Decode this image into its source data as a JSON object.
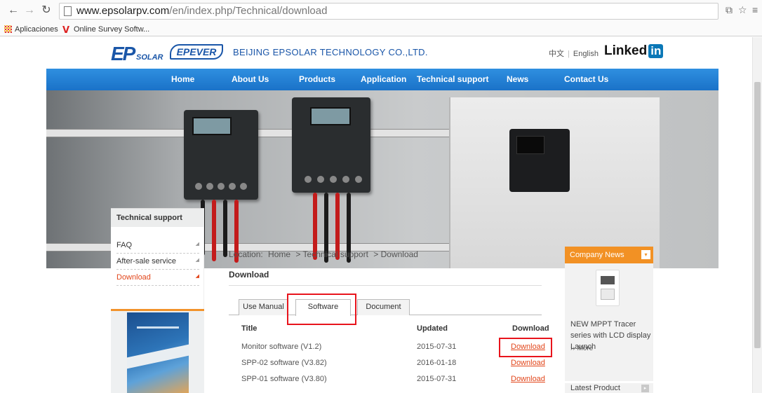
{
  "browser": {
    "url_host": "www.epsolarpv.com",
    "url_path": "/en/index.php/Technical/download",
    "back_icon": "arrow-left-icon",
    "forward_icon": "arrow-right-icon",
    "reload_icon": "reload-icon",
    "bookmarks": [
      {
        "label": "Aplicaciones",
        "icon": "apps-grid-icon"
      },
      {
        "label": "Online Survey Softw...",
        "icon": "survey-logo-icon"
      }
    ]
  },
  "header": {
    "logo_ep": "EP",
    "logo_solar": "SOLAR",
    "logo_epever": "EPEVER",
    "company": "BEIJING EPSOLAR TECHNOLOGY CO.,LTD.",
    "lang_cn": "中文",
    "lang_en": "English",
    "linkedin": "Linked",
    "linkedin_in": "in"
  },
  "nav": [
    "Home",
    "About Us",
    "Products",
    "Application",
    "Technical support",
    "News",
    "Contact Us"
  ],
  "sidebar": {
    "title": "Technical support",
    "items": [
      {
        "label": "FAQ",
        "active": false
      },
      {
        "label": "After-sale service",
        "active": false
      },
      {
        "label": "Download",
        "active": true
      }
    ]
  },
  "main": {
    "location_label": "Location:",
    "crumbs": [
      "Home",
      "> Technical support",
      "> Download"
    ],
    "title": "Download",
    "tabs": [
      "Use Manual",
      "Software",
      "Document"
    ],
    "active_tab": "Software",
    "columns": {
      "title": "Title",
      "updated": "Updated",
      "download": "Download"
    },
    "rows": [
      {
        "title": "Monitor software (V1.2)",
        "updated": "2015-07-31",
        "link": "Download"
      },
      {
        "title": "SPP-02 software (V3.82)",
        "updated": "2016-01-18",
        "link": "Download"
      },
      {
        "title": "SPP-01 software (V3.80)",
        "updated": "2015-07-31",
        "link": "Download"
      }
    ]
  },
  "news": {
    "title": "Company News",
    "toggle": "▾",
    "text": "NEW MPPT Tracer series with LCD display Launch",
    "more": "›› More",
    "latest": "Latest Product",
    "latest_toggle": "▸"
  },
  "colors": {
    "nav_blue": "#1a72c8",
    "accent_orange": "#f29124",
    "link_orange": "#e2471c",
    "highlight_red": "#e8141c"
  }
}
